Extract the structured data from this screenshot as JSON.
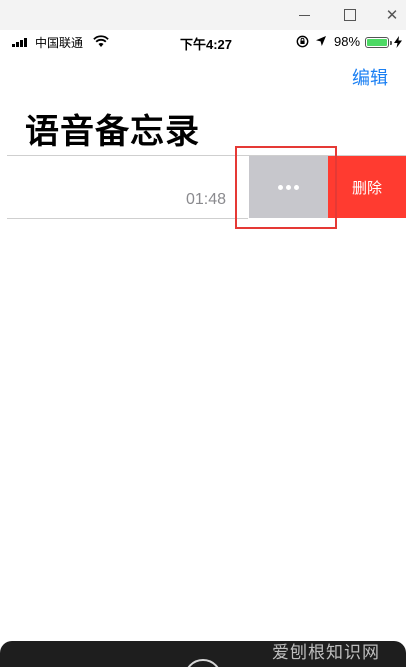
{
  "status_bar": {
    "carrier": "中国联通",
    "time": "下午4:27",
    "battery_percent": "98%",
    "battery_level": 0.98,
    "accent_battery": "#4cd964"
  },
  "nav": {
    "edit_label": "编辑",
    "accent": "#1a7ff3"
  },
  "page": {
    "title": "语音备忘录"
  },
  "recordings": [
    {
      "duration": "01:48",
      "swipe_actions": {
        "more_icon": "ellipsis-icon",
        "delete_label": "删除",
        "delete_color": "#ff3b30",
        "more_color": "#c7c7cc"
      }
    }
  ],
  "watermark": {
    "text": "爱刨根知识网"
  }
}
